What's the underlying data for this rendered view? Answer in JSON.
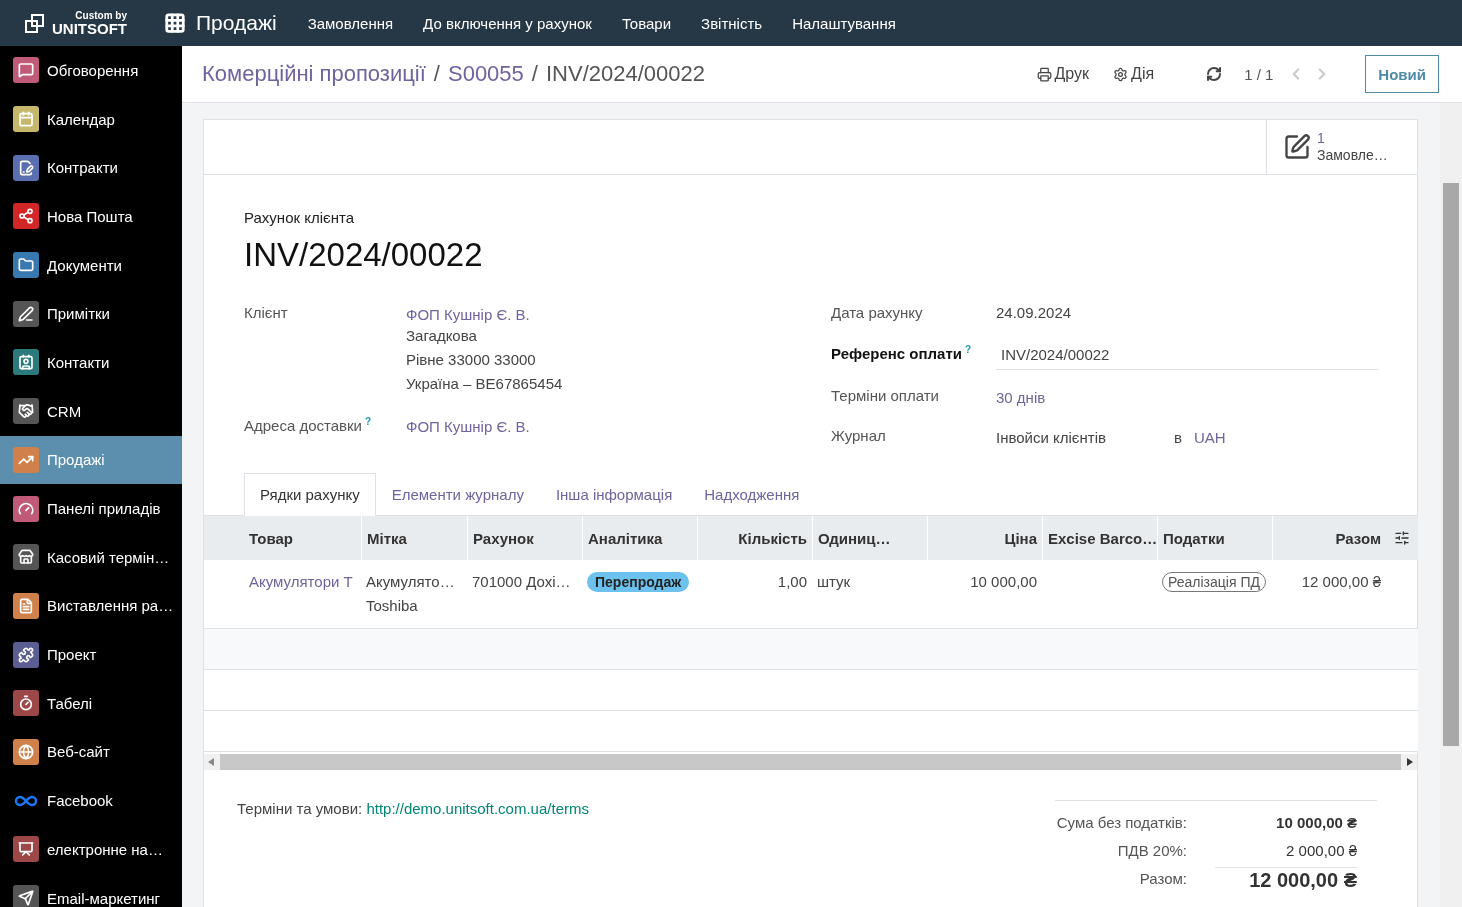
{
  "topbar": {
    "brand_small": "Custom by",
    "brand": "UNITSOFT",
    "app": "Продажі",
    "menu": [
      "Замовлення",
      "До включення у рахунок",
      "Товари",
      "Звітність",
      "Налаштування"
    ]
  },
  "sidebar": {
    "items": [
      {
        "label": "Обговорення",
        "selected": false
      },
      {
        "label": "Календар",
        "selected": false
      },
      {
        "label": "Контракти",
        "selected": false
      },
      {
        "label": "Нова Пошта",
        "selected": false
      },
      {
        "label": "Документи",
        "selected": false
      },
      {
        "label": "Примітки",
        "selected": false
      },
      {
        "label": "Контакти",
        "selected": false
      },
      {
        "label": "CRM",
        "selected": false
      },
      {
        "label": "Продажі",
        "selected": true
      },
      {
        "label": "Панелі приладів",
        "selected": false
      },
      {
        "label": "Касовий термін…",
        "selected": false
      },
      {
        "label": "Виставлення ра…",
        "selected": false
      },
      {
        "label": "Проект",
        "selected": false
      },
      {
        "label": "Табелі",
        "selected": false
      },
      {
        "label": "Веб-сайт",
        "selected": false
      },
      {
        "label": "Facebook",
        "selected": false
      },
      {
        "label": "електронне на…",
        "selected": false
      },
      {
        "label": "Email-маркетинг",
        "selected": false
      }
    ]
  },
  "control_panel": {
    "breadcrumbs": [
      "Комерційні пропозиції",
      "S00055",
      "INV/2024/00022"
    ],
    "separators": [
      "/",
      "/"
    ],
    "actions": [
      {
        "kind": "print",
        "label": "Друк"
      },
      {
        "kind": "action",
        "label": "Дія"
      }
    ],
    "pager": "1 / 1",
    "new_button": "Новий"
  },
  "form": {
    "smart_button": {
      "count": "1",
      "label": "Замовле…"
    },
    "subtitle": "Рахунок клієнта",
    "title": "INV/2024/00022",
    "left_fields": [
      {
        "kind": "partner",
        "label": "Клієнт",
        "required": false,
        "value": "ФОП Кушнір Є. В.",
        "address": [
          "Загадкова",
          "Рівне 33000 33000",
          "Україна – BE67865454"
        ]
      },
      {
        "kind": "link",
        "label": "Адреса доставки",
        "help": "?",
        "required": false,
        "value": "ФОП Кушнір Є. В."
      }
    ],
    "right_fields": [
      {
        "kind": "text",
        "label": "Дата рахунку",
        "required": false,
        "value": "24.09.2024"
      },
      {
        "kind": "input",
        "label": "Референс оплати",
        "help": "?",
        "required": true,
        "value": "INV/2024/00022"
      },
      {
        "kind": "link",
        "label": "Терміни оплати",
        "required": false,
        "value": "30 днів"
      },
      {
        "kind": "journal",
        "label": "Журнал",
        "required": false,
        "value": "Інвойси клієнтів",
        "connector": "в",
        "currency": "UAH"
      }
    ],
    "tabs": [
      {
        "label": "Рядки рахунку",
        "selected": true
      },
      {
        "label": "Елементи журналу",
        "selected": false
      },
      {
        "label": "Інша інформація",
        "selected": false
      },
      {
        "label": "Надходження",
        "selected": false
      }
    ],
    "table": {
      "columns": [
        {
          "label": "Товар",
          "kind": "text"
        },
        {
          "label": "Мітка",
          "kind": "text"
        },
        {
          "label": "Рахунок",
          "kind": "text"
        },
        {
          "label": "Аналітика",
          "kind": "text"
        },
        {
          "label": "Кількість",
          "kind": "number"
        },
        {
          "label": "Одиниц…",
          "kind": "text"
        },
        {
          "label": "Ціна",
          "kind": "number"
        },
        {
          "label": "Excise Barco…",
          "kind": "text"
        },
        {
          "label": "Податки",
          "kind": "text"
        },
        {
          "label": "Разом",
          "kind": "number"
        }
      ],
      "rows": [
        {
          "cells": [
            {
              "kind": "link",
              "text": "Акумулятори Т"
            },
            {
              "kind": "text",
              "text": "Акумулято… Toshiba"
            },
            {
              "kind": "text",
              "text": "701000 Дохі…"
            },
            {
              "kind": "tag",
              "text": "Перепродаж"
            },
            {
              "kind": "number",
              "text": "1,00"
            },
            {
              "kind": "text",
              "text": "штук"
            },
            {
              "kind": "number",
              "text": "10 000,00"
            },
            {
              "kind": "empty"
            },
            {
              "kind": "outline",
              "text": "Реалізація ПД"
            },
            {
              "kind": "number",
              "text": "12 000,00 ₴"
            }
          ]
        }
      ]
    },
    "terms": {
      "label": "Терміни та умови:",
      "link": "http://demo.unitsoft.com.ua/terms"
    },
    "totals": [
      {
        "kind": "subtotal",
        "label": "Сума без податків:",
        "value": "10 000,00 ₴"
      },
      {
        "kind": "tax",
        "label": "ПДВ 20%:",
        "value": "2 000,00 ₴"
      },
      {
        "kind": "total",
        "label": "Разом:",
        "value": "12 000,00 ₴"
      }
    ]
  }
}
